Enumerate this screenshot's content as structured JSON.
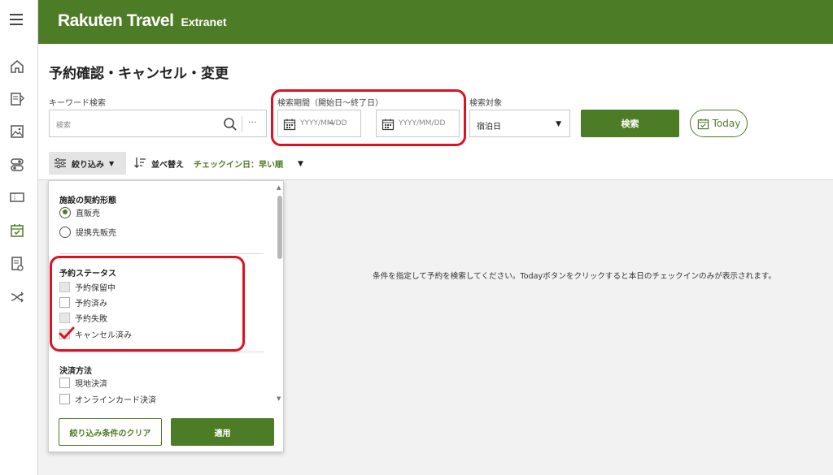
{
  "app": {
    "brand": "Rakuten Travel",
    "sub": "Extranet"
  },
  "page": {
    "title": "予約確認・キャンセル・変更"
  },
  "keyword": {
    "label": "キーワード検索",
    "placeholder": "検索",
    "more": "···"
  },
  "period": {
    "label": "検索期間（開始日〜終了日）",
    "from_placeholder": "YYYY/MM/DD",
    "to_placeholder": "YYYY/MM/DD",
    "separator": "~"
  },
  "target": {
    "label": "検索対象",
    "value": "宿泊日"
  },
  "buttons": {
    "search": "検索",
    "today": "Today"
  },
  "toolbar": {
    "filter": "絞り込み",
    "sort_label": "並べ替え",
    "sort_value": "チェックイン日：早い順"
  },
  "message": "条件を指定して予約を検索してください。Todayボタンをクリックすると本日のチェックインのみが表示されます。",
  "filter_panel": {
    "contract": {
      "title": "施設の契約形態",
      "options": [
        "直販売",
        "提携先販売"
      ],
      "selected": "直販売"
    },
    "status": {
      "title": "予約ステータス",
      "options": [
        {
          "label": "予約保留中",
          "checked": false,
          "disabled": true
        },
        {
          "label": "予約済み",
          "checked": false,
          "disabled": false
        },
        {
          "label": "予約失敗",
          "checked": false,
          "disabled": true
        },
        {
          "label": "キャンセル済み",
          "checked": true,
          "disabled": true
        }
      ]
    },
    "payment": {
      "title": "決済方法",
      "options": [
        "現地決済",
        "オンラインカード決済"
      ]
    },
    "clear": "絞り込み条件のクリア",
    "apply": "適用"
  },
  "colors": {
    "brand_green": "#4d7c26",
    "highlight_red": "#e01020"
  }
}
